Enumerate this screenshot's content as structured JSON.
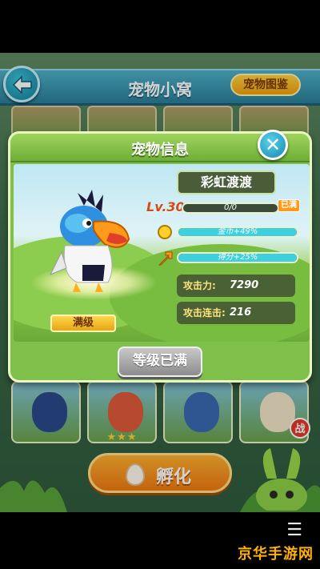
{
  "header": {
    "title": "宠物小窝",
    "album_label": "宠物图鉴"
  },
  "modal": {
    "title": "宠物信息",
    "pet_name": "彩虹渡渡",
    "level_label": "Lv.30",
    "xp_text": "0/0",
    "xp_fraction": 0,
    "maxed_badge": "已满",
    "coin_bonus": "金币+49%",
    "coin_fraction": 1.0,
    "score_bonus": "得分+25%",
    "score_fraction": 1.0,
    "attack_label": "攻击力:",
    "attack_value": "7290",
    "combo_label": "攻击连击:",
    "combo_value": "216",
    "level_tag": "满级",
    "max_button": "等级已满"
  },
  "hatch": {
    "label": "孵化"
  },
  "badge": {
    "war": "战"
  },
  "watermark": {
    "text": "京华手游网"
  },
  "colors": {
    "accent": "#7ec04a",
    "bar_fill": "#3fd0e0",
    "orange": "#ff9a1a"
  }
}
